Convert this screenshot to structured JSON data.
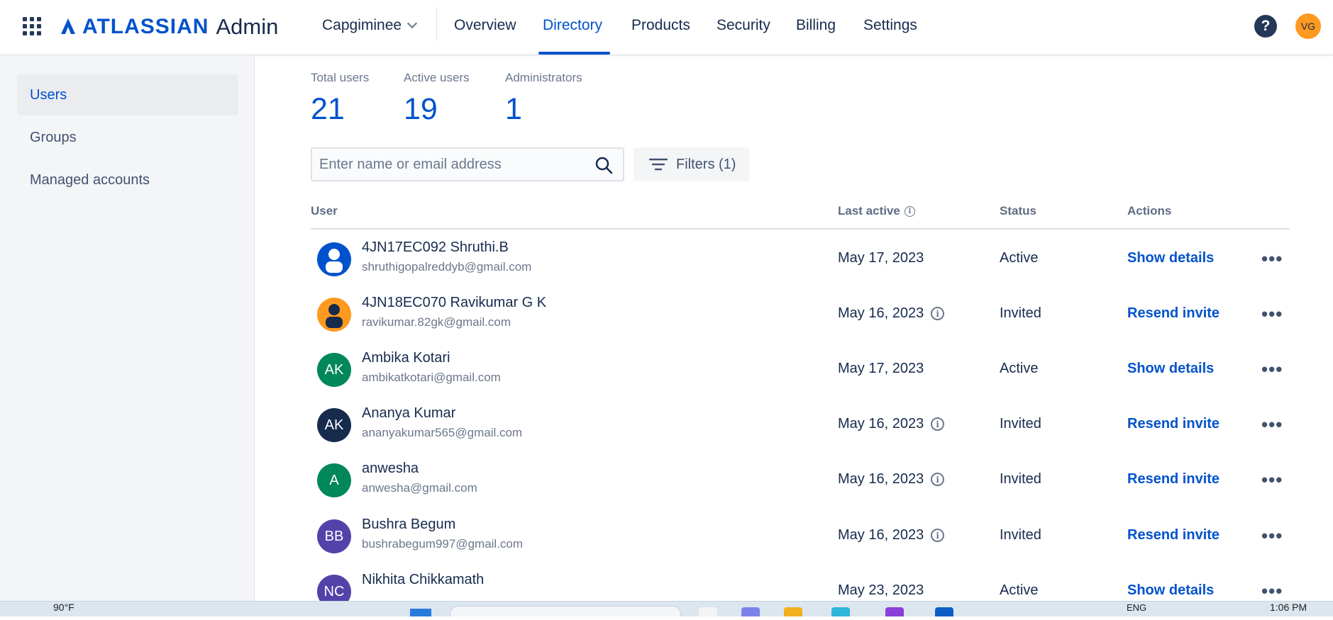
{
  "header": {
    "brand": "ATLASSIAN",
    "product": "Admin",
    "org": "Capgiminee",
    "nav": [
      {
        "label": "Overview"
      },
      {
        "label": "Directory"
      },
      {
        "label": "Products"
      },
      {
        "label": "Security"
      },
      {
        "label": "Billing"
      },
      {
        "label": "Settings"
      }
    ],
    "help": "?",
    "user_initials": "VG",
    "colors": {
      "accent": "#0052cc",
      "avatar": "#ff991f"
    }
  },
  "sidebar": {
    "items": [
      {
        "label": "Users"
      },
      {
        "label": "Groups"
      },
      {
        "label": "Managed accounts"
      }
    ]
  },
  "stats": {
    "total_label": "Total users",
    "total_value": "21",
    "active_label": "Active users",
    "active_value": "19",
    "admin_label": "Administrators",
    "admin_value": "1"
  },
  "search": {
    "placeholder": "Enter name or email address",
    "filters_label": "Filters (1)"
  },
  "table": {
    "headers": {
      "user": "User",
      "last_active": "Last active",
      "status": "Status",
      "actions": "Actions"
    },
    "rows": [
      {
        "name": "4JN17EC092 Shruthi.B",
        "email": "shruthigopalreddyb@gmail.com",
        "last_active": "May 17, 2023",
        "status": "Active",
        "action": "Show details",
        "initials": "",
        "avatar_color": "#0052cc"
      },
      {
        "name": "4JN18EC070 Ravikumar G K",
        "email": "ravikumar.82gk@gmail.com",
        "last_active": "May 16, 2023",
        "status": "Invited",
        "action": "Resend invite",
        "initials": "",
        "avatar_color": "#ff991f"
      },
      {
        "name": "Ambika Kotari",
        "email": "ambikatkotari@gmail.com",
        "last_active": "May 17, 2023",
        "status": "Active",
        "action": "Show details",
        "initials": "AK",
        "avatar_color": "#00875a"
      },
      {
        "name": "Ananya Kumar",
        "email": "ananyakumar565@gmail.com",
        "last_active": "May 16, 2023",
        "status": "Invited",
        "action": "Resend invite",
        "initials": "AK",
        "avatar_color": "#172b4d"
      },
      {
        "name": "anwesha",
        "email": "anwesha@gmail.com",
        "last_active": "May 16, 2023",
        "status": "Invited",
        "action": "Resend invite",
        "initials": "A",
        "avatar_color": "#00875a"
      },
      {
        "name": "Bushra Begum",
        "email": "bushrabegum997@gmail.com",
        "last_active": "May 16, 2023",
        "status": "Invited",
        "action": "Resend invite",
        "initials": "BB",
        "avatar_color": "#5243aa"
      },
      {
        "name": "Nikhita Chikkamath",
        "email": "",
        "last_active": "May 23, 2023",
        "status": "Active",
        "action": "Show details",
        "initials": "NC",
        "avatar_color": "#5243aa"
      }
    ],
    "more": "•••"
  },
  "taskbar": {
    "weather": "90°F",
    "lang": "ENG",
    "time": "1:06 PM"
  }
}
